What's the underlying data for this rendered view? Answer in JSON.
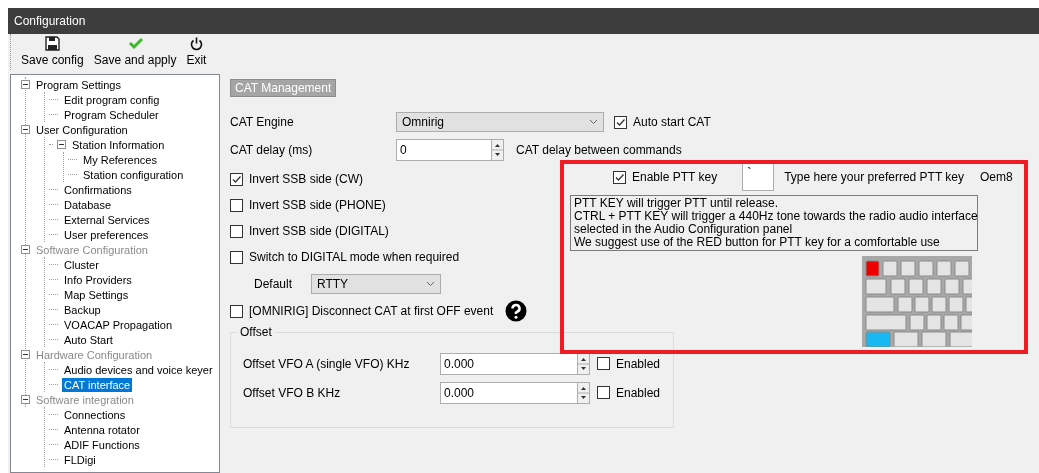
{
  "window": {
    "title": "Configuration"
  },
  "toolbar": [
    {
      "kind": "save",
      "label": "Save config"
    },
    {
      "kind": "apply",
      "label": "Save and apply"
    },
    {
      "kind": "exit",
      "label": "Exit"
    }
  ],
  "tree": [
    {
      "label": "Program Settings",
      "disabled": false,
      "selected": false,
      "expanded": true,
      "children": [
        {
          "label": "Edit program config",
          "disabled": false,
          "selected": false
        },
        {
          "label": "Program Scheduler",
          "disabled": false,
          "selected": false
        }
      ]
    },
    {
      "label": "User Configuration",
      "disabled": false,
      "selected": false,
      "expanded": true,
      "children": [
        {
          "label": "Station Information",
          "disabled": false,
          "selected": false,
          "expanded": true,
          "children": [
            {
              "label": "My References",
              "disabled": false,
              "selected": false
            },
            {
              "label": "Station configuration",
              "disabled": false,
              "selected": false
            }
          ]
        },
        {
          "label": "Confirmations",
          "disabled": false,
          "selected": false
        },
        {
          "label": "Database",
          "disabled": false,
          "selected": false
        },
        {
          "label": "External Services",
          "disabled": false,
          "selected": false
        },
        {
          "label": "User preferences",
          "disabled": false,
          "selected": false
        }
      ]
    },
    {
      "label": "Software Configuration",
      "disabled": true,
      "selected": false,
      "expanded": true,
      "children": [
        {
          "label": "Cluster",
          "disabled": false,
          "selected": false
        },
        {
          "label": "Info Providers",
          "disabled": false,
          "selected": false
        },
        {
          "label": "Map Settings",
          "disabled": false,
          "selected": false
        },
        {
          "label": "Backup",
          "disabled": false,
          "selected": false
        },
        {
          "label": "VOACAP Propagation",
          "disabled": false,
          "selected": false
        },
        {
          "label": "Auto Start",
          "disabled": false,
          "selected": false
        }
      ]
    },
    {
      "label": "Hardware Configuration",
      "disabled": true,
      "selected": false,
      "expanded": true,
      "children": [
        {
          "label": "Audio devices and voice keyer",
          "disabled": false,
          "selected": false
        },
        {
          "label": "CAT interface",
          "disabled": false,
          "selected": true
        }
      ]
    },
    {
      "label": "Software integration",
      "disabled": true,
      "selected": false,
      "expanded": true,
      "children": [
        {
          "label": "Connections",
          "disabled": false,
          "selected": false
        },
        {
          "label": "Antenna rotator",
          "disabled": false,
          "selected": false
        },
        {
          "label": "ADIF Functions",
          "disabled": false,
          "selected": false
        },
        {
          "label": "FLDigi",
          "disabled": false,
          "selected": false
        }
      ]
    }
  ],
  "panel": {
    "title": "CAT Management",
    "cat_engine": {
      "label": "CAT Engine",
      "value": "Omnirig"
    },
    "auto_start": {
      "label": "Auto start CAT",
      "checked": true
    },
    "cat_delay": {
      "label": "CAT delay (ms)",
      "value": "0",
      "note": "CAT delay between commands"
    },
    "options": [
      {
        "label": "Invert SSB side (CW)",
        "checked": true
      },
      {
        "label": "Invert SSB side (PHONE)",
        "checked": false
      },
      {
        "label": "Invert SSB side (DIGITAL)",
        "checked": false
      },
      {
        "label": "Switch to DIGITAL mode when required",
        "checked": false
      }
    ],
    "default_mode": {
      "label": "Default",
      "value": "RTTY"
    },
    "omnirig_disconnect": {
      "label": "[OMNIRIG] Disconnect CAT at first OFF event",
      "checked": false
    },
    "offset": {
      "title": "Offset",
      "rows": [
        {
          "label": "Offset VFO A (single VFO) KHz",
          "value": "0.000",
          "enabled_label": "Enabled",
          "checked": false
        },
        {
          "label": "Offset VFO B KHz",
          "value": "0.000",
          "enabled_label": "Enabled",
          "checked": false
        }
      ]
    },
    "ptt": {
      "label": "Enable PTT key",
      "checked": true,
      "key": "`",
      "hint": "Type here your preferred PTT key",
      "key_name": "Oem8",
      "info": [
        "PTT KEY will trigger PTT until release.",
        "CTRL + PTT KEY will trigger a 440Hz tone towards the radio audio interface",
        "selected in the Audio Configuration panel",
        "We suggest use of the RED button for PTT key for a comfortable use"
      ]
    }
  },
  "highlight": {
    "shown": true
  }
}
